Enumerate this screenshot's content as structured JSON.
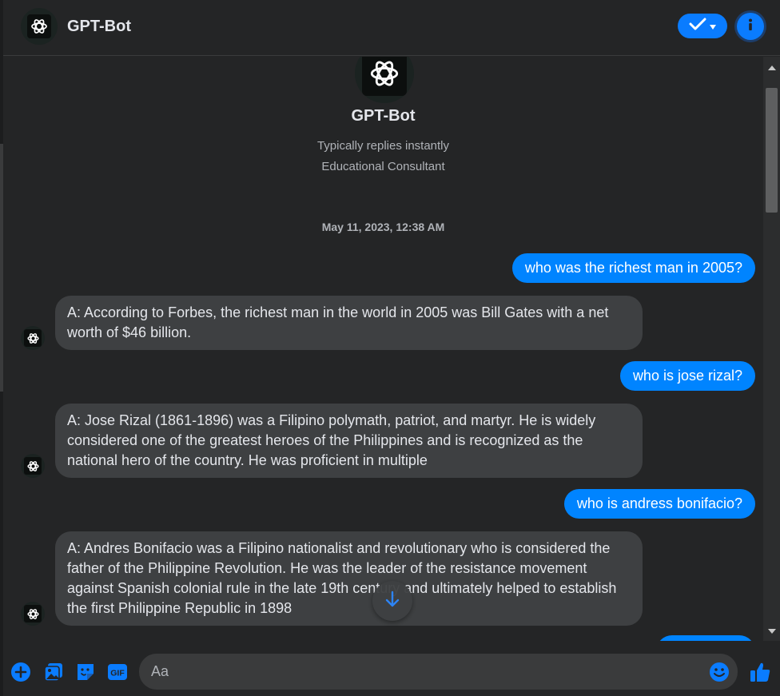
{
  "colors": {
    "accent": "#0084ff",
    "background": "#242526",
    "incoming_bubble": "#3e4042",
    "input_background": "#3a3b3c"
  },
  "header": {
    "title": "GPT-Bot",
    "avatar_icon": "openai-logo-icon",
    "status_icon": "check-icon",
    "info_icon": "info-icon"
  },
  "profile": {
    "name": "GPT-Bot",
    "reply_speed": "Typically replies instantly",
    "role": "Educational Consultant"
  },
  "timestamp": "May 11, 2023, 12:38 AM",
  "messages": [
    {
      "direction": "outgoing",
      "text": "who was the richest man in 2005?"
    },
    {
      "direction": "incoming",
      "text": "A: According to Forbes, the richest man in the world in 2005 was Bill Gates with a net worth of $46 billion."
    },
    {
      "direction": "outgoing",
      "text": "who is jose rizal?"
    },
    {
      "direction": "incoming",
      "text": "A: Jose Rizal (1861-1896) was a Filipino polymath, patriot, and martyr. He is widely considered one of the greatest heroes of the Philippines and is recognized as the national hero of the country. He was proficient in multiple"
    },
    {
      "direction": "outgoing",
      "text": "who is andress bonifacio?"
    },
    {
      "direction": "incoming",
      "text": "A: Andres Bonifacio was a Filipino nationalist and revolutionary who is considered the father of the Philippine Revolution. He was the leader of the resistance movement against Spanish colonial rule in the late 19th century and ultimately helped to establish the first Philippine Republic in 1898"
    }
  ],
  "composer": {
    "placeholder": "Aa",
    "icons": [
      "plus-circle-icon",
      "photo-icon",
      "sticker-icon",
      "gif-icon",
      "emoji-icon",
      "thumbs-up-icon"
    ],
    "gif_label": "GIF"
  }
}
